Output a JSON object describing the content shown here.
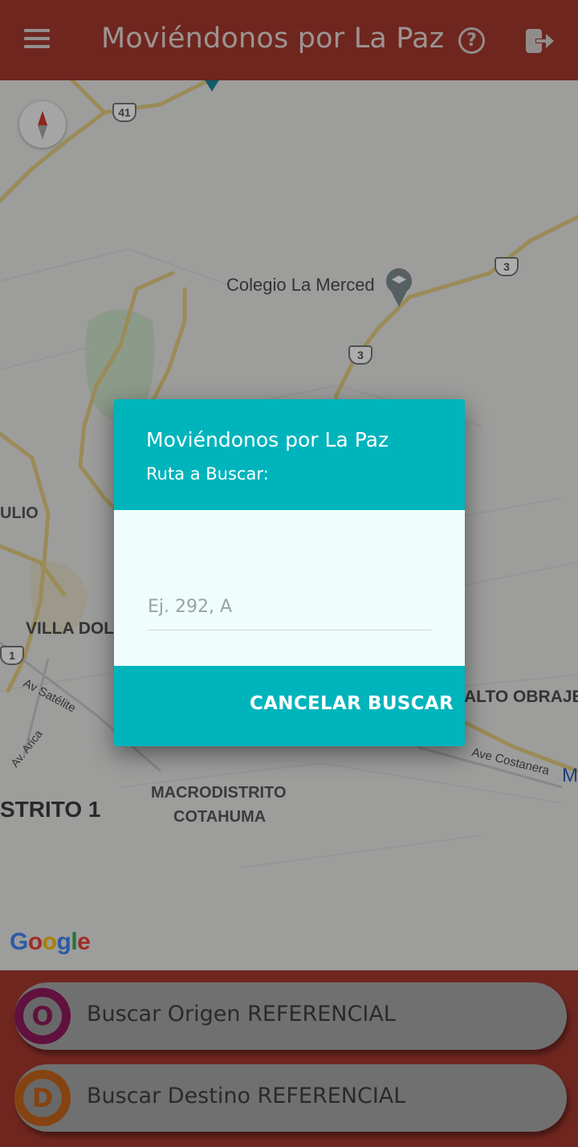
{
  "app_bar": {
    "title": "Moviéndonos por La Paz",
    "menu_icon": "hamburger-menu-icon",
    "help_icon": "help-circle-icon",
    "help_glyph": "?",
    "logout_icon": "logout-icon",
    "background_color": "#a4382e"
  },
  "map": {
    "compass_icon": "compass-icon",
    "labels": {
      "colegio": "Colegio La Merced",
      "villa": "VILLA DOL",
      "ulio": "ULIO",
      "satelite": "Av Satélite",
      "arica": "Av. Arica",
      "distrito": "STRITO 1",
      "macrodistrito_1": "MACRODISTRITO",
      "macrodistrito_2": "COTAHUMA",
      "alto_obrajes": "ALTO OBRAJE",
      "costanera": "Ave Costanera",
      "m_edge": "M"
    },
    "route_shields": {
      "r41": "41",
      "r3a": "3",
      "r3b": "3",
      "r1": "1"
    },
    "attribution": "Google",
    "poi_icon": "school-pin-icon"
  },
  "dialog": {
    "title": "Moviéndonos por La Paz",
    "subtitle": "Ruta a Buscar:",
    "input_value": "",
    "input_placeholder": "Ej. 292, A",
    "cancel_label": "CANCELAR",
    "search_label": "BUSCAR",
    "accent_color": "#00b4bc"
  },
  "bottom": {
    "origin": {
      "badge_letter": "O",
      "label": "Buscar Origen REFERENCIAL",
      "badge_color": "#8e1a5c"
    },
    "destination": {
      "badge_letter": "D",
      "label": "Buscar Destino REFERENCIAL",
      "badge_color": "#c4631a"
    }
  }
}
